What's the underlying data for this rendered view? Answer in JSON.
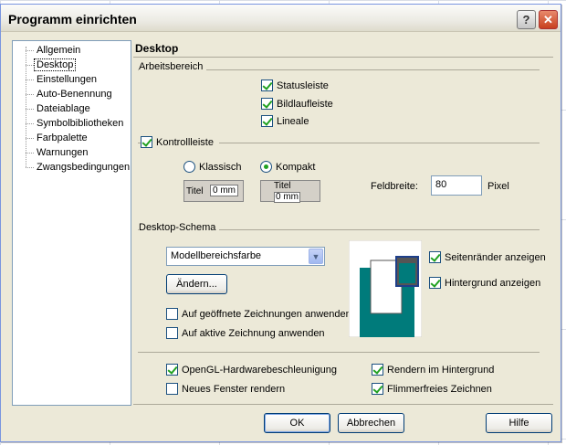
{
  "window": {
    "title": "Programm einrichten"
  },
  "titlebar": {
    "help_glyph": "?",
    "close_glyph": "✕"
  },
  "tree": {
    "items": [
      {
        "label": "Allgemein"
      },
      {
        "label": "Desktop"
      },
      {
        "label": "Einstellungen"
      },
      {
        "label": "Auto-Benennung"
      },
      {
        "label": "Dateiablage"
      },
      {
        "label": "Symbolbibliotheken"
      },
      {
        "label": "Farbpalette"
      },
      {
        "label": "Warnungen"
      },
      {
        "label": "Zwangsbedingungen"
      }
    ],
    "selected": "Desktop"
  },
  "panel": {
    "title": "Desktop"
  },
  "arbeitsbereich": {
    "label": "Arbeitsbereich",
    "statusleiste": {
      "label": "Statusleiste",
      "checked": true
    },
    "bildlaufleiste": {
      "label": "Bildlaufleiste",
      "checked": true
    },
    "lineale": {
      "label": "Lineale",
      "checked": true
    }
  },
  "kontrollleiste": {
    "label": "Kontrollleiste",
    "checked": true,
    "klassisch": {
      "label": "Klassisch",
      "selected": false
    },
    "kompakt": {
      "label": "Kompakt",
      "selected": true
    },
    "preview_classic": {
      "title": "Titel",
      "value": "0 mm"
    },
    "preview_compact": {
      "title": "Titel",
      "value": "0 mm"
    },
    "feldbreite_label": "Feldbreite:",
    "feldbreite_value": "80",
    "feldbreite_unit": "Pixel"
  },
  "schema": {
    "label": "Desktop-Schema",
    "select_value": "Modellbereichsfarbe",
    "aendern_label": "Ändern...",
    "auf_geoeffnete": {
      "label": "Auf geöffnete Zeichnungen anwenden",
      "checked": false
    },
    "auf_aktive": {
      "label": "Auf aktive Zeichnung anwenden",
      "checked": false
    },
    "seitenraender": {
      "label": "Seitenränder anzeigen",
      "checked": true
    },
    "hintergrund": {
      "label": "Hintergrund anzeigen",
      "checked": true
    },
    "preview_color": "#007b7b"
  },
  "rendering": {
    "opengl": {
      "label": "OpenGL-Hardwarebeschleunigung",
      "checked": true
    },
    "neues_fenster": {
      "label": "Neues Fenster rendern",
      "checked": false
    },
    "hintergrund": {
      "label": "Rendern im Hintergrund",
      "checked": true
    },
    "flimmerfrei": {
      "label": "Flimmerfreies Zeichnen",
      "checked": true
    }
  },
  "footer": {
    "ok": "OK",
    "abbrechen": "Abbrechen",
    "hilfe": "Hilfe"
  }
}
